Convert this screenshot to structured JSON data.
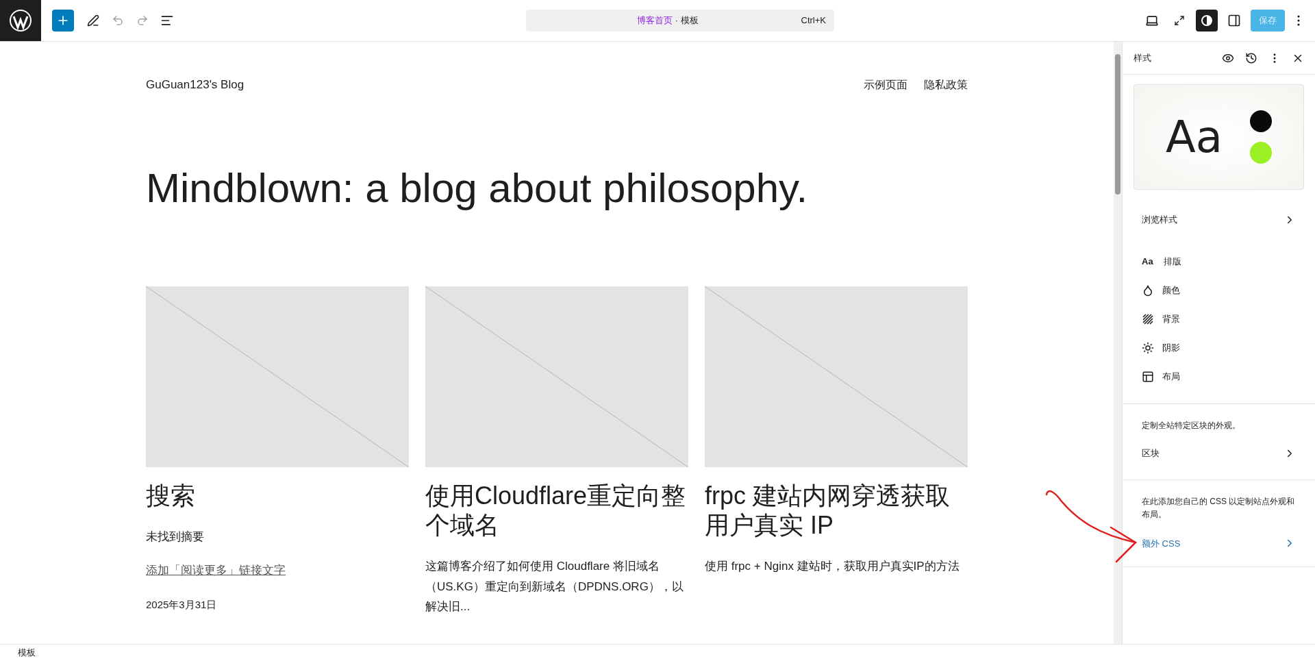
{
  "top_bar": {
    "document": {
      "page": "博客首页",
      "separator": " · ",
      "type": "模板"
    },
    "shortcut": "Ctrl+K",
    "save_button": "保存",
    "style_toggle_selected": true
  },
  "canvas": {
    "site_title": "GuGuan123's Blog",
    "nav": [
      "示例页面",
      "隐私政策"
    ],
    "heading": "Mindblown: a blog about philosophy.",
    "posts": [
      {
        "title": "搜索",
        "excerpt": "未找到摘要",
        "read_more": "添加「阅读更多」链接文字",
        "date": "2025年3月31日"
      },
      {
        "title": "使用Cloudflare重定向整个域名",
        "excerpt": "这篇博客介绍了如何使用 Cloudflare 将旧域名（US.KG）重定向到新域名（DPDNS.ORG），以解决旧..."
      },
      {
        "title": "frpc 建站内网穿透获取用户真实 IP",
        "excerpt": "使用 frpc + Nginx 建站时，获取用户真实IP的方法"
      }
    ]
  },
  "sidebar": {
    "title": "样式",
    "preview": {
      "sample": "Aa",
      "colors": [
        {
          "color": "#0a0a0a"
        },
        {
          "color": "#9bf024"
        }
      ]
    },
    "browse": "浏览样式",
    "items": [
      {
        "kind": "typography",
        "icon_text": "Aa",
        "label": "排版"
      },
      {
        "kind": "color",
        "label": "颜色"
      },
      {
        "kind": "background",
        "label": "背景"
      },
      {
        "kind": "shadow",
        "label": "阴影"
      },
      {
        "kind": "layout",
        "label": "布局"
      }
    ],
    "blocks_hint": "定制全站特定区块的外观。",
    "blocks": "区块",
    "css_hint": "在此添加您自己的 CSS 以定制站点外观和布局。",
    "css": "额外 CSS"
  },
  "status_bar": "模板"
}
